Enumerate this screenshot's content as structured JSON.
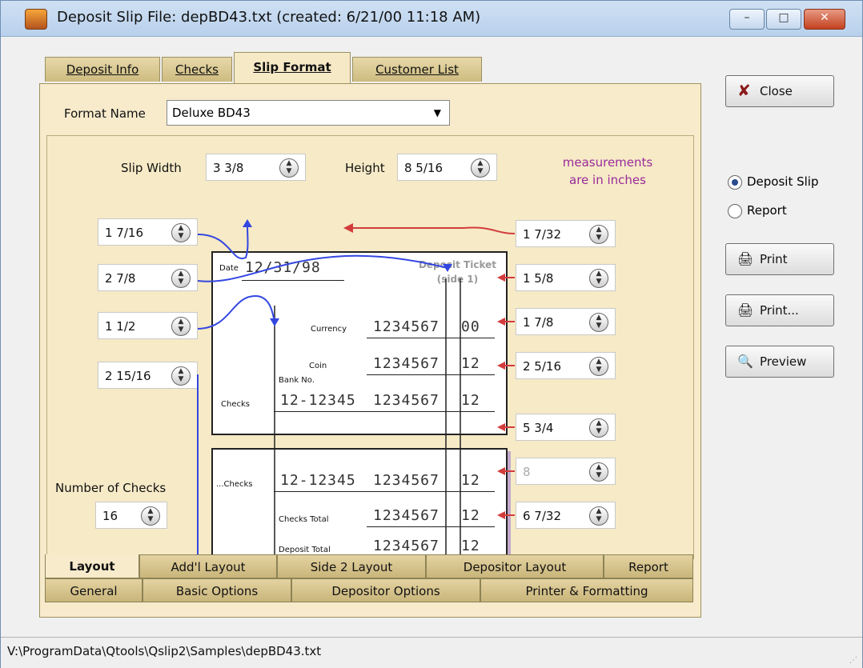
{
  "window": {
    "title": "Deposit Slip File:  depBD43.txt  (created: 6/21/00 11:18 AM)",
    "controls": {
      "minimize": "–",
      "maximize": "□",
      "close": "✕"
    }
  },
  "top_tabs": [
    {
      "label": "Deposit Info"
    },
    {
      "label": "Checks"
    },
    {
      "label": "Slip Format",
      "active": true
    },
    {
      "label": "Customer List"
    }
  ],
  "format": {
    "label": "Format Name",
    "value": "Deluxe BD43"
  },
  "dimensions": {
    "width_label": "Slip Width",
    "width_value": "3 3/8",
    "height_label": "Height",
    "height_value": "8 5/16",
    "note_line1": "measurements",
    "note_line2": "are in inches"
  },
  "left_fields": [
    "1 7/16",
    "2 7/8",
    "1 1/2",
    "2 15/16"
  ],
  "right_fields": [
    "1 7/32",
    "1 5/8",
    "1 7/8",
    "2 5/16",
    "5 3/4",
    "8",
    "6 7/32"
  ],
  "number_of_checks": {
    "label": "Number of Checks",
    "value": "16"
  },
  "slip": {
    "date_label": "Date",
    "date_value": "12/31/98",
    "ticket_line1": "Deposit Ticket",
    "ticket_line2": "(side 1)",
    "currency_label": "Currency",
    "currency_amount": "1234567",
    "currency_cents": "00",
    "coin_label": "Coin",
    "coin_amount": "1234567",
    "coin_cents": "12",
    "bank_no_label": "Bank No.",
    "checks_label": "Checks",
    "check_bank": "12-12345",
    "check_amount": "1234567",
    "check_cents": "12",
    "more_checks_label": "...Checks",
    "more_check_bank": "12-12345",
    "more_check_amount": "1234567",
    "more_check_cents": "12",
    "checks_total_label": "Checks Total",
    "checks_total_amount": "1234567",
    "checks_total_cents": "12",
    "deposit_total_label": "Deposit Total",
    "deposit_total_amount": "1234567",
    "deposit_total_cents": "12"
  },
  "bottom_tabs_row1": [
    {
      "label": "Layout",
      "active": true
    },
    {
      "label": "Add'l Layout"
    },
    {
      "label": "Side 2 Layout"
    },
    {
      "label": "Depositor Layout"
    },
    {
      "label": "Report"
    }
  ],
  "bottom_tabs_row2": [
    {
      "label": "General"
    },
    {
      "label": "Basic Options"
    },
    {
      "label": "Depositor Options"
    },
    {
      "label": "Printer & Formatting"
    }
  ],
  "side": {
    "close_label": "Close",
    "deposit_slip_label": "Deposit Slip",
    "report_label": "Report",
    "print_label": "Print",
    "print_dialog_label": "Print...",
    "preview_label": "Preview"
  },
  "status": {
    "path": "V:\\ProgramData\\Qtools\\Qslip2\\Samples\\depBD43.txt"
  },
  "colors": {
    "panel": "#f7ebcc",
    "tab": "#d6c48c",
    "arrow_blue": "#3347e0",
    "arrow_red": "#d33c3c",
    "note": "#9a2b9a"
  }
}
